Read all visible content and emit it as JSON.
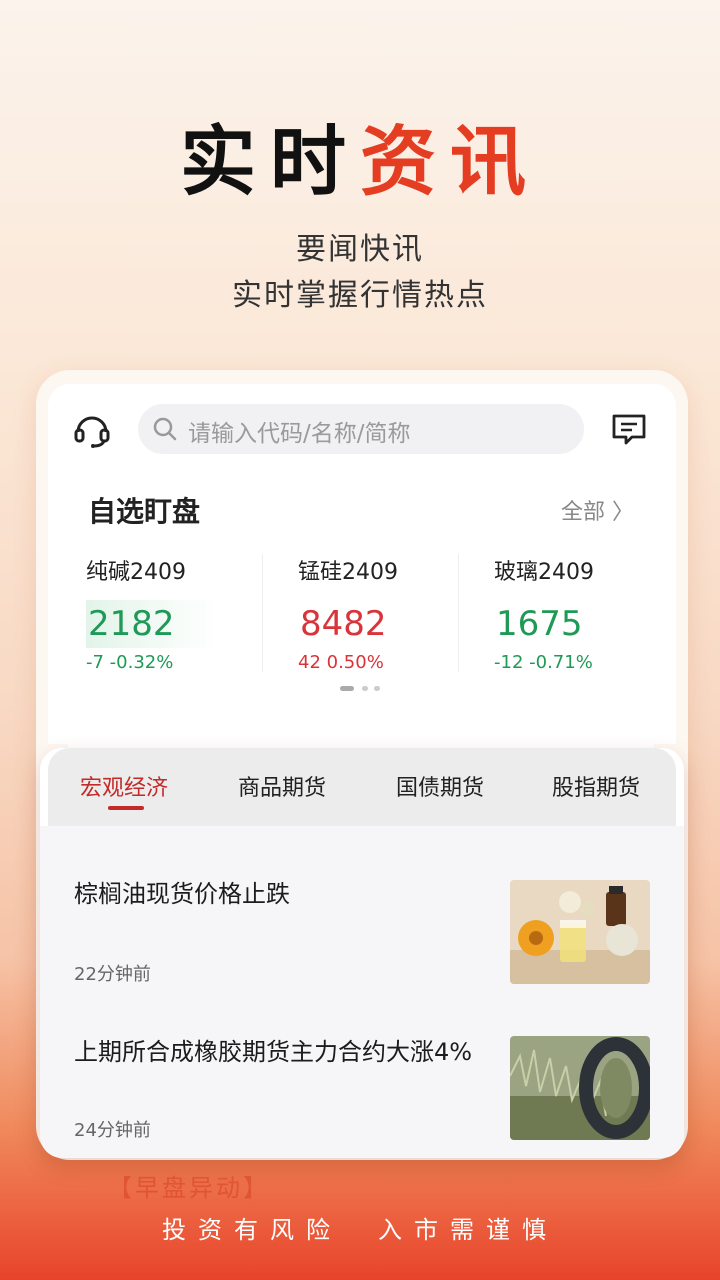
{
  "hero": {
    "title_dark": "实时",
    "title_red": "资讯",
    "subtitle_1": "要闻快讯",
    "subtitle_2": "实时掌握行情热点"
  },
  "topbar": {
    "search_placeholder": "请输入代码/名称/简称",
    "icons": [
      "headset-icon",
      "search-icon",
      "message-icon"
    ]
  },
  "watchlist": {
    "title": "自选盯盘",
    "all_label": "全部 〉",
    "items": [
      {
        "name": "纯碱2409",
        "price": "2182",
        "change": "-7  -0.32%",
        "color": "#1f9a56"
      },
      {
        "name": "锰硅2409",
        "price": "8482",
        "change": "42  0.50%",
        "color": "#d8343a"
      },
      {
        "name": "玻璃2409",
        "price": "1675",
        "change": "-12  -0.71%",
        "color": "#1f9a56"
      }
    ]
  },
  "news": {
    "tabs": [
      "宏观经济",
      "商品期货",
      "国债期货",
      "股指期货"
    ],
    "active_tab": 0,
    "items": [
      {
        "title": "棕榈油现货价格止跌",
        "time": "22分钟前"
      },
      {
        "title": "上期所合成橡胶期货主力合约大涨4%",
        "time": "24分钟前"
      }
    ]
  },
  "footer": {
    "text": "投资有风险　入市需谨慎",
    "ghost_text": "【早盘异动】"
  },
  "colors": {
    "accent_red": "#e43d22",
    "up_red": "#d8343a",
    "down_green": "#1f9a56",
    "tab_active": "#c42a2a"
  }
}
